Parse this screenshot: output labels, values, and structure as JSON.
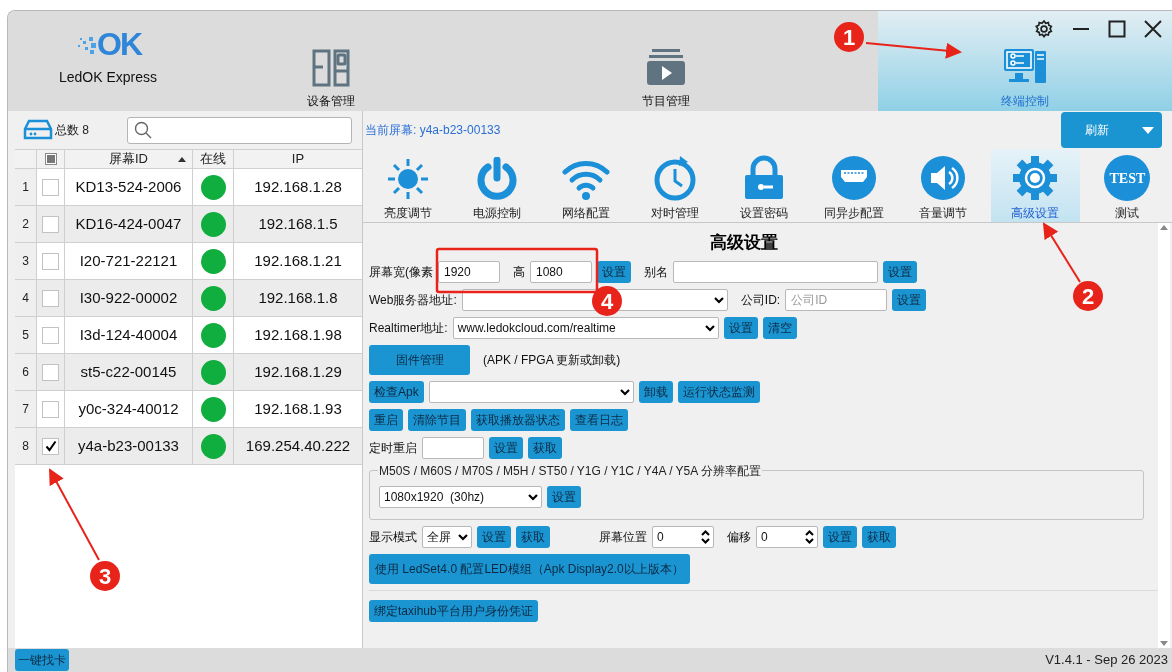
{
  "app": {
    "logo": "OK",
    "title": "LedOK Express"
  },
  "nav_tabs": [
    {
      "label": "设备管理",
      "selected": false
    },
    {
      "label": "节目管理",
      "selected": false
    },
    {
      "label": "终端控制",
      "selected": true
    }
  ],
  "device_panel": {
    "total": "总数 8",
    "select_all_partial": true,
    "columns": [
      "屏幕ID",
      "在线",
      "IP"
    ],
    "rows": [
      {
        "index": "1",
        "checked": false,
        "screen_id": "KD13-524-2006",
        "online": true,
        "ip": "192.168.1.28"
      },
      {
        "index": "2",
        "checked": false,
        "screen_id": "KD16-424-0047",
        "online": true,
        "ip": "192.168.1.5"
      },
      {
        "index": "3",
        "checked": false,
        "screen_id": "I20-721-22121",
        "online": true,
        "ip": "192.168.1.21"
      },
      {
        "index": "4",
        "checked": false,
        "screen_id": "I30-922-00002",
        "online": true,
        "ip": "192.168.1.8"
      },
      {
        "index": "5",
        "checked": false,
        "screen_id": "I3d-124-40004",
        "online": true,
        "ip": "192.168.1.98"
      },
      {
        "index": "6",
        "checked": false,
        "screen_id": "st5-c22-00145",
        "online": true,
        "ip": "192.168.1.29"
      },
      {
        "index": "7",
        "checked": false,
        "screen_id": "y0c-324-40012",
        "online": true,
        "ip": "192.168.1.93"
      },
      {
        "index": "8",
        "checked": true,
        "screen_id": "y4a-b23-00133",
        "online": true,
        "ip": "169.254.40.222"
      }
    ]
  },
  "current_screen": "当前屏幕: y4a-b23-00133",
  "refresh_button": "刷新",
  "tools": [
    {
      "label": "亮度调节",
      "selected": false
    },
    {
      "label": "电源控制",
      "selected": false
    },
    {
      "label": "网络配置",
      "selected": false
    },
    {
      "label": "对时管理",
      "selected": false
    },
    {
      "label": "设置密码",
      "selected": false
    },
    {
      "label": "同异步配置",
      "selected": false
    },
    {
      "label": "音量调节",
      "selected": false
    },
    {
      "label": "高级设置",
      "selected": true
    },
    {
      "label": "测试",
      "selected": false,
      "icon_text": "TEST"
    }
  ],
  "panel_title": "高级设置",
  "sections": [
    {
      "kind": "row",
      "items": [
        {
          "kind": "label",
          "text": "屏幕宽(像素"
        },
        {
          "kind": "input",
          "value": "1920"
        },
        {
          "kind": "label",
          "text": "高"
        },
        {
          "kind": "input",
          "value": "1080"
        },
        {
          "kind": "button",
          "text": "设置"
        },
        {
          "kind": "label",
          "text": "别名"
        },
        {
          "kind": "input"
        },
        {
          "kind": "button",
          "text": "设置"
        }
      ]
    },
    {
      "kind": "row",
      "items": [
        {
          "kind": "label",
          "text": "Web服务器地址:"
        },
        {
          "kind": "select"
        },
        {
          "kind": "label",
          "text": "公司ID:"
        },
        {
          "kind": "input",
          "placeholder": "公司ID"
        },
        {
          "kind": "button",
          "text": "设置"
        }
      ]
    },
    {
      "kind": "row",
      "items": [
        {
          "kind": "label",
          "text": "Realtimer地址:"
        },
        {
          "kind": "select",
          "value": "www.ledokcloud.com/realtime"
        },
        {
          "kind": "button",
          "text": "设置"
        },
        {
          "kind": "button",
          "text": "清空"
        }
      ]
    },
    {
      "kind": "row",
      "items": [
        {
          "kind": "big_button",
          "text": "固件管理"
        },
        {
          "kind": "label",
          "text": "(APK / FPGA 更新或卸载)"
        }
      ]
    },
    {
      "kind": "row",
      "items": [
        {
          "kind": "button",
          "text": "检查Apk"
        },
        {
          "kind": "select"
        },
        {
          "kind": "button",
          "text": "卸载"
        },
        {
          "kind": "button",
          "text": "运行状态监测"
        }
      ]
    },
    {
      "kind": "row",
      "items": [
        {
          "kind": "button",
          "text": "重启"
        },
        {
          "kind": "button",
          "text": "清除节目"
        },
        {
          "kind": "button",
          "text": "获取播放器状态"
        },
        {
          "kind": "button",
          "text": "查看日志"
        }
      ]
    },
    {
      "kind": "row",
      "items": [
        {
          "kind": "label",
          "text": "定时重启"
        },
        {
          "kind": "input"
        },
        {
          "kind": "button",
          "text": "设置"
        },
        {
          "kind": "button",
          "text": "获取"
        }
      ]
    },
    {
      "kind": "group",
      "legend": "M50S / M60S / M70S / M5H / ST50 / Y1G / Y1C / Y4A / Y5A 分辨率配置",
      "items": [
        {
          "kind": "select",
          "value": "1080x1920  (30hz)"
        },
        {
          "kind": "button",
          "text": "设置"
        }
      ]
    },
    {
      "kind": "row",
      "items": [
        {
          "kind": "label",
          "text": "显示模式"
        },
        {
          "kind": "select",
          "value": "全屏"
        },
        {
          "kind": "button",
          "text": "设置"
        },
        {
          "kind": "button",
          "text": "获取"
        },
        {
          "kind": "label",
          "text": "屏幕位置"
        },
        {
          "kind": "spin",
          "value": "0"
        },
        {
          "kind": "label",
          "text": "偏移"
        },
        {
          "kind": "spin",
          "value": "0"
        },
        {
          "kind": "button",
          "text": "设置"
        },
        {
          "kind": "button",
          "text": "获取"
        }
      ]
    },
    {
      "kind": "row",
      "items": [
        {
          "kind": "big_button",
          "text": "使用 LedSet4.0 配置LED模组（Apk Display2.0以上版本）"
        }
      ]
    },
    {
      "kind": "row",
      "items": [
        {
          "kind": "button",
          "text": "绑定taxihub平台用户身份凭证"
        }
      ]
    }
  ],
  "status_bar": {
    "find_button": "一键找卡",
    "version": "V1.4.1 - Sep 26 2023"
  },
  "annotations": [
    {
      "label": "1"
    },
    {
      "label": "2"
    },
    {
      "label": "3"
    },
    {
      "label": "4"
    }
  ]
}
